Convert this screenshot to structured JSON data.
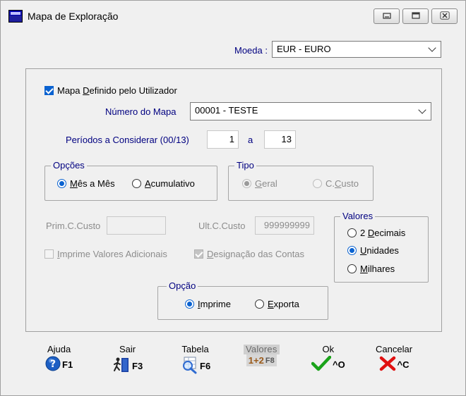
{
  "window": {
    "title": "Mapa de Exploração"
  },
  "currency": {
    "label": "Moeda",
    "colon": ":",
    "value": "EUR - EURO"
  },
  "custom_map": {
    "label_pre": "Mapa ",
    "label_u": "D",
    "label_post": "efinido pelo Utilizador",
    "checked": true
  },
  "map_number": {
    "label": "Número do Mapa",
    "value": "00001 - TESTE"
  },
  "periods": {
    "label": "Períodos a Considerar (00/13)",
    "from": "1",
    "sep": "a",
    "to": "13"
  },
  "options": {
    "title": "Opções",
    "month": {
      "u": "M",
      "rest": "ês a Mês",
      "selected": true
    },
    "cumulative": {
      "u": "A",
      "rest": "cumulativo",
      "selected": false
    }
  },
  "type": {
    "title": "Tipo",
    "general": {
      "u": "G",
      "rest": "eral",
      "selected": true
    },
    "cost_center": {
      "pre": "C.",
      "u": "C",
      "rest": "usto",
      "selected": false
    }
  },
  "cost_center": {
    "first_label": "Prim.C.Custo",
    "first_value": "",
    "last_label": "Ult.C.Custo",
    "last_value": "999999999"
  },
  "print_extra": {
    "u": "I",
    "rest": "mprime Valores Adicionais",
    "checked": false
  },
  "account_names": {
    "u": "D",
    "rest": "esignação das Contas",
    "checked": true
  },
  "values": {
    "title": "Valores",
    "dec2": {
      "pre": "2 ",
      "u": "D",
      "rest": "ecimais",
      "selected": false
    },
    "units": {
      "u": "U",
      "rest": "nidades",
      "selected": true
    },
    "thousands": {
      "u": "M",
      "rest": "ilhares",
      "selected": false
    }
  },
  "output": {
    "title": "Opção",
    "print": {
      "u": "I",
      "rest": "mprime",
      "selected": true
    },
    "export": {
      "u": "E",
      "rest": "xporta",
      "selected": false
    }
  },
  "toolbar": {
    "help": {
      "label": "Ajuda",
      "key": "F1"
    },
    "exit": {
      "label": "Sair",
      "key": "F3"
    },
    "table": {
      "label": "Tabela",
      "key": "F6"
    },
    "values": {
      "label": "Valores",
      "key": "F8",
      "digits": "1+2"
    },
    "ok": {
      "label": "Ok",
      "key": "^O"
    },
    "cancel": {
      "label": "Cancelar",
      "key": "^C"
    }
  },
  "colors": {
    "accent": "#0a62d0",
    "group_title": "#000080",
    "disabled": "#8c8c8c",
    "ok": "#1aa31a",
    "cancel": "#e01010",
    "help": "#1d5fc4"
  }
}
